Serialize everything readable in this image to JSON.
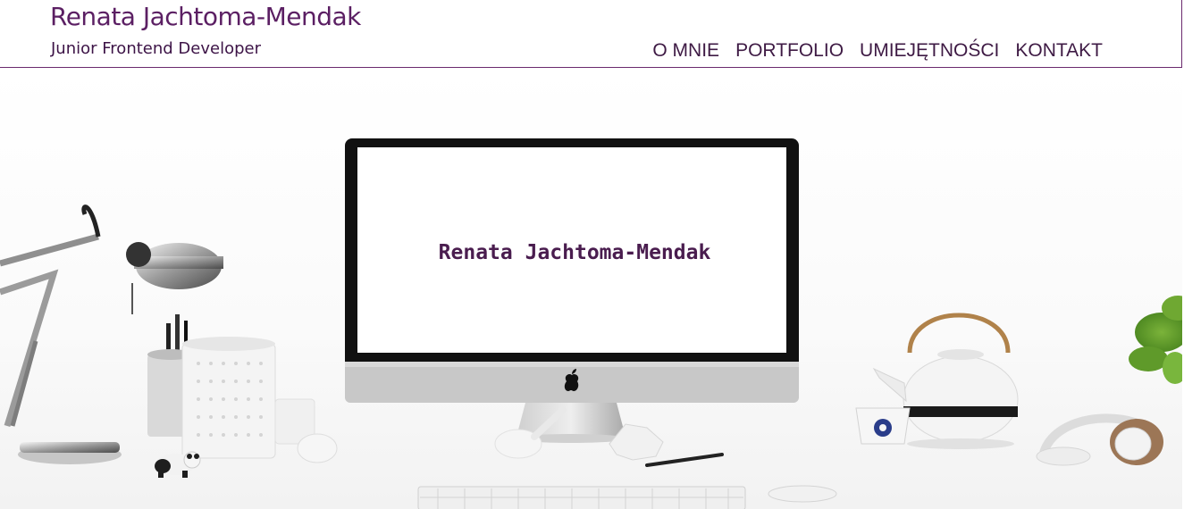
{
  "header": {
    "name": "Renata Jachtoma-Mendak",
    "subtitle": "Junior Frontend Developer"
  },
  "nav": {
    "items": [
      {
        "label": "O MNIE"
      },
      {
        "label": "PORTFOLIO"
      },
      {
        "label": "UMIEJĘTNOŚCI"
      },
      {
        "label": "KONTAKT"
      }
    ]
  },
  "hero": {
    "screen_text": "Renata Jachtoma-Mendak"
  },
  "colors": {
    "accent": "#5b1f63",
    "nav_text": "#3e1a44",
    "border": "#6b2a6e"
  },
  "icons": [
    "apple-logo-icon"
  ]
}
